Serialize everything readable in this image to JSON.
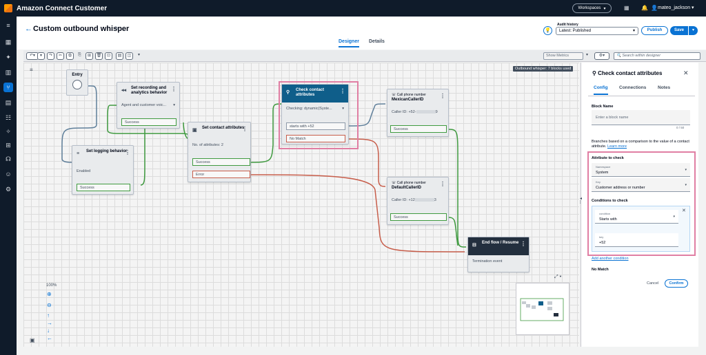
{
  "app": {
    "brand": "Amazon Connect Customer"
  },
  "topbar": {
    "workspaces": "Workspaces",
    "user": "mateo_jackson",
    "icons": [
      "grid-icon",
      "bell-icon",
      "user-icon"
    ]
  },
  "nav": {
    "icons": [
      "menu-icon",
      "dashboard-icon",
      "routing-icon",
      "analytics-icon",
      "flows-icon",
      "channels-icon",
      "users-icon",
      "contact-lens-icon",
      "queues-icon",
      "phone-icon",
      "agent-icon",
      "settings-icon"
    ]
  },
  "page": {
    "title": "Custom outbound whisper",
    "tabs": [
      "Designer",
      "Details"
    ],
    "active_tab": "Designer"
  },
  "header": {
    "audit_label": "Audit history",
    "audit_value": "Latest: Published",
    "publish": "Publish",
    "save": "Save"
  },
  "toolbar": {
    "show_metrics": "Show Metrics",
    "search_placeholder": "Search within designer"
  },
  "canvas": {
    "banner": "Outbound whisper: 7 blocks used",
    "zoom": "100%",
    "blocks": {
      "entry": {
        "title": "Entry"
      },
      "logging": {
        "title": "Set logging behavior",
        "body": "Enabled",
        "port": "Success"
      },
      "recording": {
        "title": "Set recording and analytics behavior",
        "body": "Agent and customer voic...",
        "port": "Success"
      },
      "contactattrs": {
        "title": "Set contact attributes",
        "body": "No. of attributes: 2",
        "port_success": "Success",
        "port_error": "Error"
      },
      "check": {
        "title": "Check contact attributes",
        "body": "Checking: dynamic(Syste...",
        "port_cond": "starts with +52",
        "port_nomatch": "No Match"
      },
      "mexican": {
        "kicker": "Call phone number",
        "title": "MexicanCallerID",
        "body_prefix": "Caller ID: +52-",
        "body_suffix": "9",
        "port": "Success"
      },
      "default": {
        "kicker": "Call phone number",
        "title": "DefaultCallerID",
        "body_prefix": "Caller ID: +12",
        "body_suffix": "3",
        "port": "Success"
      },
      "end": {
        "title": "End flow / Resume",
        "body": "Termination event"
      }
    }
  },
  "panel": {
    "title": "Check contact attributes",
    "tabs": [
      "Config",
      "Connections",
      "Notes"
    ],
    "active_tab": "Config",
    "block_name_label": "Block Name",
    "block_name_placeholder": "Enter a block name",
    "counter": "0 / 50",
    "description": "Branches based on a comparison to the value of a contact attribute.",
    "learn_more": "Learn more",
    "attr_section": "Attribute to check",
    "namespace_label": "Namespace",
    "namespace_value": "System",
    "key_label": "Key",
    "key_value": "Customer address or number",
    "cond_section": "Conditions to check",
    "condition_label": "condition",
    "condition_value": "Starts with",
    "val_label": "key",
    "val_value": "+52",
    "add_condition": "Add another condition",
    "no_match": "No Match",
    "cancel": "Cancel",
    "confirm": "Confirm"
  },
  "colors": {
    "accent": "#0972d3",
    "success": "#3f9a3f",
    "error": "#c75d4a",
    "highlight": "#e07ea3",
    "nav": "#0f1b2a"
  }
}
